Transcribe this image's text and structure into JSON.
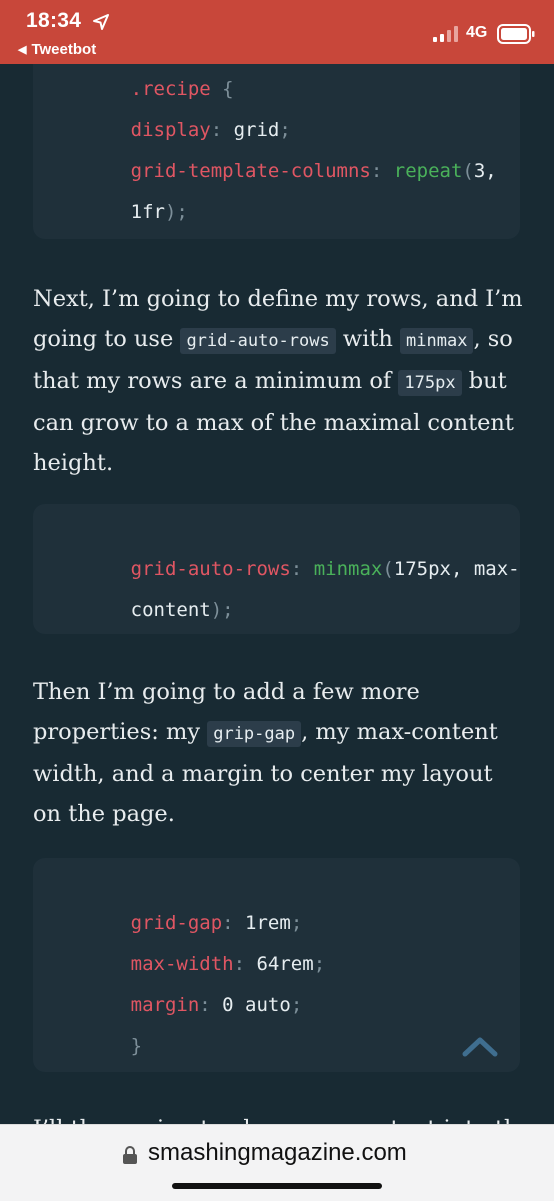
{
  "status_bar": {
    "time": "18:34",
    "back_app": "Tweetbot",
    "network": "4G",
    "colors": {
      "background": "#c8473a"
    }
  },
  "article": {
    "code_block_1": {
      "line1": {
        "selector": ".recipe",
        "brace": " {"
      },
      "line2": {
        "prop": "display",
        "colon": ":",
        "value": " grid",
        "semi": ";"
      },
      "line3": {
        "prop": "grid-template-columns",
        "colon": ":",
        "fn": " repeat",
        "paren": "(",
        "value": "3,"
      },
      "line4": {
        "value": "1fr",
        "close": ");"
      }
    },
    "paragraph_1": {
      "part1": "Next, I’m going to define my rows, and I’m going to use ",
      "code1": "grid-auto-rows",
      "part2": " with ",
      "code2": "minmax",
      "part3": ", so that my rows are a minimum of ",
      "code3": "175px",
      "part4": " but can grow to a max of the maximal content height."
    },
    "code_block_2": {
      "line1": {
        "prop": "grid-auto-rows",
        "colon": ":",
        "fn": " minmax",
        "paren": "(",
        "value": "175px, max-"
      },
      "line2": {
        "value": "content",
        "close": ");"
      }
    },
    "paragraph_2": {
      "part1": "Then I’m going to add a few more properties: my ",
      "code1": "grip-gap",
      "part2": ", my max-content width, and a margin to center my layout on the page."
    },
    "code_block_3": {
      "line1": {
        "prop": "grid-gap",
        "colon": ":",
        "value": " 1rem",
        "semi": ";"
      },
      "line2": {
        "prop": "max-width",
        "colon": ":",
        "value": " 64rem",
        "semi": ";"
      },
      "line3": {
        "prop": "margin",
        "colon": ":",
        "value": " 0 auto",
        "semi": ";"
      },
      "line4": {
        "close": "}"
      }
    },
    "partial_text": "I’ll then going to also some content into the"
  },
  "url_bar": {
    "domain": "smashingmagazine.com"
  },
  "icons": [
    "location-arrow-icon",
    "signal-icon",
    "battery-icon",
    "scroll-to-top-icon",
    "lock-icon"
  ]
}
